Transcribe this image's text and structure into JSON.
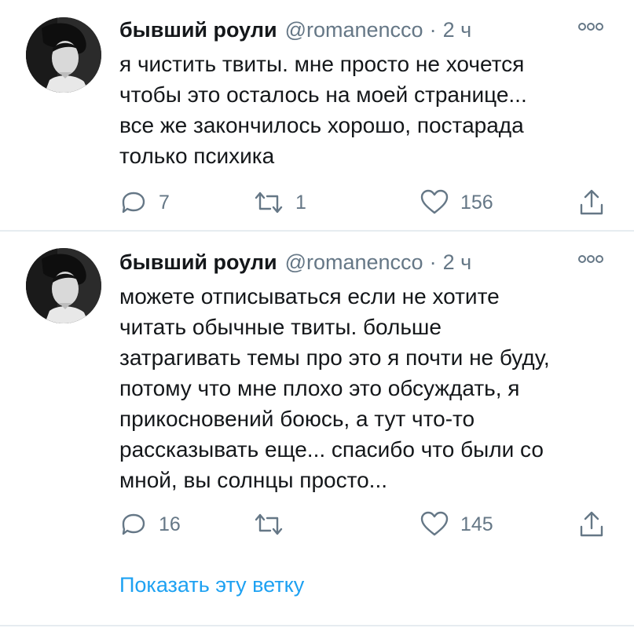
{
  "tweets": [
    {
      "author_name": "бывший роули",
      "handle": "@romanencco",
      "separator": "·",
      "time": "2 ч",
      "text": "я чистить твиты. мне просто не хочется\nчтобы это осталось на моей странице...\nвсе же закончилось хорошо, постарада\nтолько психика",
      "replies": "7",
      "retweets": "1",
      "likes": "156"
    },
    {
      "author_name": "бывший роули",
      "handle": "@romanencco",
      "separator": "·",
      "time": "2 ч",
      "text": "можете отписываться если не хотите\nчитать обычные твиты. больше\nзатрагивать темы про это я почти не буду,\nпотому что мне плохо это обсуждать, я\nприкосновений боюсь, а тут что-то\nрассказывать еще... спасибо что были со\nмной, вы солнцы просто...",
      "replies": "16",
      "retweets": "",
      "likes": "145"
    }
  ],
  "show_thread_label": "Показать эту ветку",
  "icons": {
    "reply": "reply-icon",
    "retweet": "retweet-icon",
    "like": "heart-icon",
    "share": "share-icon",
    "more": "more-options-icon"
  },
  "colors": {
    "text": "#14171a",
    "secondary": "#657786",
    "link": "#1da1f2",
    "divider": "#e6ecf0"
  }
}
